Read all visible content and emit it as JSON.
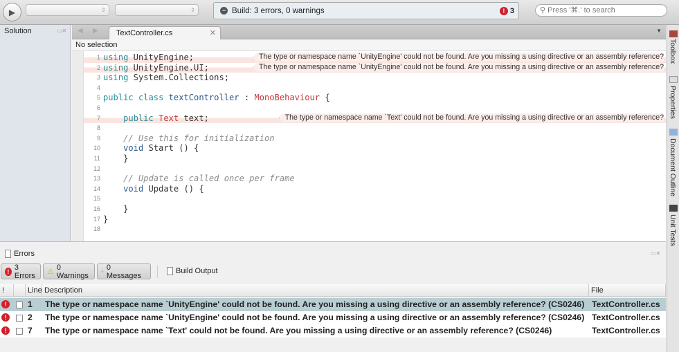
{
  "toolbar": {
    "status_text": "Build: 3 errors, 0 warnings",
    "error_count": "3",
    "search_placeholder": "Press '⌘.' to search"
  },
  "sidebar": {
    "title": "Solution"
  },
  "editor": {
    "tab_label": "TextController.cs",
    "selection": "No selection",
    "lines": [
      {
        "n": "1",
        "segs": [
          [
            "kw",
            "using"
          ],
          [
            "pl",
            " UnityEngine;"
          ]
        ],
        "error": "The type or namespace name `UnityEngine' could not be found. Are you missing a using directive or an assembly reference?"
      },
      {
        "n": "2",
        "segs": [
          [
            "kw",
            "using"
          ],
          [
            "pl",
            " UnityEngine.UI;"
          ]
        ],
        "error": "The type or namespace name `UnityEngine' could not be found. Are you missing a using directive or an assembly reference?"
      },
      {
        "n": "3",
        "segs": [
          [
            "kw",
            "using"
          ],
          [
            "pl",
            " System.Collections;"
          ]
        ]
      },
      {
        "n": "4",
        "segs": []
      },
      {
        "n": "5",
        "segs": [
          [
            "kw",
            "public class"
          ],
          [
            "pl",
            " "
          ],
          [
            "id",
            "textController"
          ],
          [
            "pl",
            " : "
          ],
          [
            "ty",
            "MonoBehaviour"
          ],
          [
            "pl",
            " {"
          ]
        ]
      },
      {
        "n": "6",
        "segs": []
      },
      {
        "n": "7",
        "segs": [
          [
            "pl",
            "    "
          ],
          [
            "kw",
            "public"
          ],
          [
            "pl",
            " "
          ],
          [
            "ty",
            "Text"
          ],
          [
            "pl",
            " text;"
          ]
        ],
        "error": "The type or namespace name `Text' could not be found. Are you missing a using directive or an assembly reference?"
      },
      {
        "n": "8",
        "segs": []
      },
      {
        "n": "9",
        "segs": [
          [
            "cm",
            "    // Use this for initialization"
          ]
        ]
      },
      {
        "n": "10",
        "segs": [
          [
            "pl",
            "    "
          ],
          [
            "id",
            "void"
          ],
          [
            "pl",
            " Start () {"
          ]
        ]
      },
      {
        "n": "11",
        "segs": [
          [
            "pl",
            "    }"
          ]
        ]
      },
      {
        "n": "12",
        "segs": []
      },
      {
        "n": "13",
        "segs": [
          [
            "cm",
            "    // Update is called once per frame"
          ]
        ]
      },
      {
        "n": "14",
        "segs": [
          [
            "pl",
            "    "
          ],
          [
            "id",
            "void"
          ],
          [
            "pl",
            " Update () {"
          ]
        ]
      },
      {
        "n": "15",
        "segs": []
      },
      {
        "n": "16",
        "segs": [
          [
            "pl",
            "    }"
          ]
        ]
      },
      {
        "n": "17",
        "segs": [
          [
            "pl",
            "}"
          ]
        ]
      },
      {
        "n": "18",
        "segs": []
      }
    ]
  },
  "dock": {
    "items": [
      "Toolbox",
      "Properties",
      "Document Outline",
      "Unit Tests"
    ]
  },
  "errors_panel": {
    "title": "Errors",
    "filters": {
      "errors": "3 Errors",
      "warnings": "0 Warnings",
      "messages": "0 Messages",
      "build_output": "Build Output"
    },
    "columns": {
      "icon": "!",
      "line": "Line",
      "description": "Description",
      "file": "File"
    },
    "rows": [
      {
        "line": "1",
        "description": "The type or namespace name `UnityEngine' could not be found. Are you missing a using directive or an assembly reference? (CS0246)",
        "file": "TextController.cs"
      },
      {
        "line": "2",
        "description": "The type or namespace name `UnityEngine' could not be found. Are you missing a using directive or an assembly reference? (CS0246)",
        "file": "TextController.cs"
      },
      {
        "line": "7",
        "description": "The type or namespace name `Text' could not be found. Are you missing a using directive or an assembly reference? (CS0246)",
        "file": "TextController.cs"
      }
    ]
  },
  "colors": {
    "error": "#d0202a",
    "keyword": "#2a8e98",
    "type": "#c4373f",
    "selected_row": "#b8ced3"
  }
}
